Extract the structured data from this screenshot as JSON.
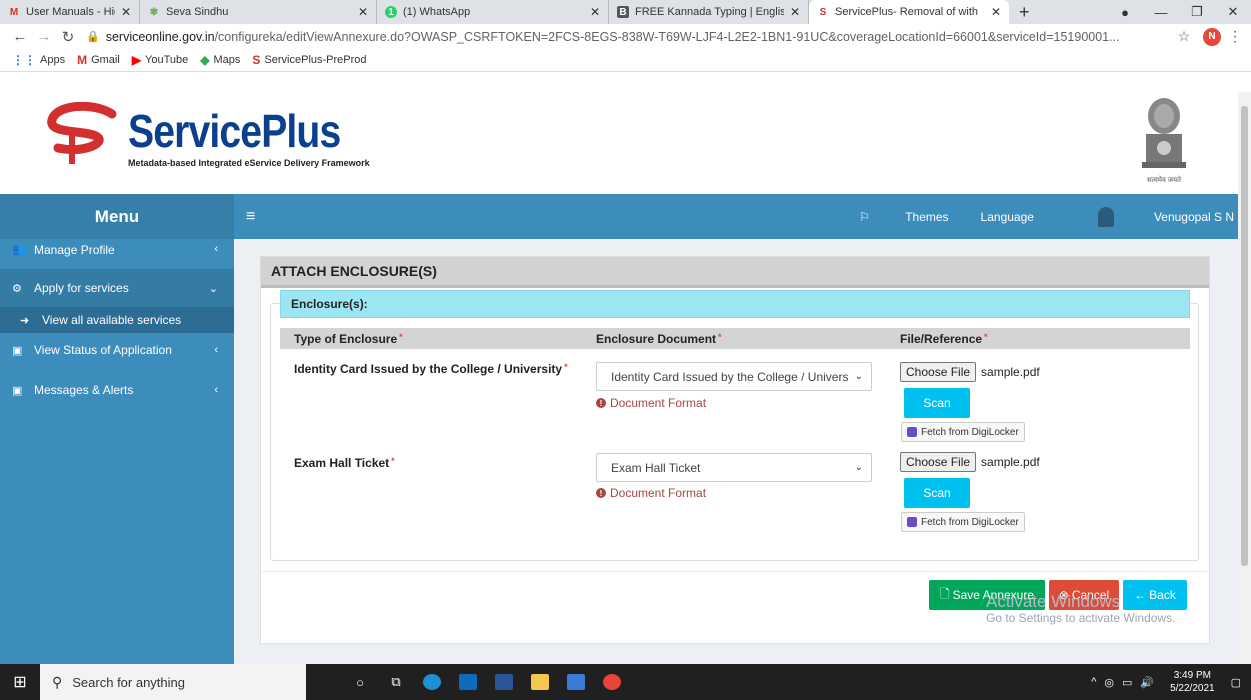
{
  "browser": {
    "tabs": [
      {
        "label": "User Manuals - Higher Educa",
        "icon": "gmail-icon"
      },
      {
        "label": "Seva Sindhu",
        "icon": "seva-sindhu-icon"
      },
      {
        "label": "(1) WhatsApp",
        "icon": "whatsapp-icon"
      },
      {
        "label": "FREE Kannada Typing | Englis",
        "icon": "kannada-typing-icon"
      },
      {
        "label": "ServicePlus- Removal of with",
        "icon": "serviceplus-icon"
      }
    ],
    "url_host": "serviceonline.gov.in",
    "url_path": "/configureka/editViewAnnexure.do?OWASP_CSRFTOKEN=2FCS-8EGS-838W-T69W-LJF4-L2E2-1BN1-91UC&coverageLocationId=66001&serviceId=15190001...",
    "profile_initial": "N",
    "bookmarks": [
      "Apps",
      "Gmail",
      "YouTube",
      "Maps",
      "ServicePlus-PreProd"
    ]
  },
  "brand": {
    "name": "ServicePlus",
    "tagline": "Metadata-based Integrated eService Delivery Framework",
    "emblem_text": "सत्यमेव जयते"
  },
  "sidebar": {
    "title": "Menu",
    "items": [
      {
        "label": "Manage Profile",
        "icon": "users-icon"
      },
      {
        "label": "Apply for services",
        "icon": "cogs-icon"
      },
      {
        "label": "View all available services",
        "icon": "arrow-circle-icon"
      },
      {
        "label": "View Status of Application",
        "icon": "window-icon"
      },
      {
        "label": "Messages & Alerts",
        "icon": "window-icon"
      }
    ]
  },
  "topnav": {
    "themes": "Themes",
    "language": "Language",
    "user": "Venugopal S N"
  },
  "page": {
    "title": "ATTACH ENCLOSURE(S)",
    "section": "Enclosure(s):",
    "columns": [
      "Type of Enclosure",
      "Enclosure Document",
      "File/Reference"
    ],
    "rows": [
      {
        "type": "Identity Card Issued by the College / University",
        "document": "Identity Card Issued by the College / Univers",
        "format_link": "Document Format",
        "choose_label": "Choose File",
        "file": "sample.pdf",
        "scan": "Scan",
        "digilocker": "Fetch from DigiLocker"
      },
      {
        "type": "Exam Hall Ticket",
        "document": "Exam Hall Ticket",
        "format_link": "Document Format",
        "choose_label": "Choose File",
        "file": "sample.pdf",
        "scan": "Scan",
        "digilocker": "Fetch from DigiLocker"
      }
    ],
    "buttons": {
      "save": "Save Annexure",
      "cancel": "Cancel",
      "back": "Back"
    },
    "colors": {
      "save": "#00a65a",
      "cancel": "#dd4b39",
      "back": "#00c0ef"
    }
  },
  "watermark": {
    "line1": "Activate Windows",
    "line2": "Go to Settings to activate Windows."
  },
  "taskbar": {
    "search_placeholder": "Search for anything",
    "time": "3:49 PM",
    "date": "5/22/2021"
  }
}
